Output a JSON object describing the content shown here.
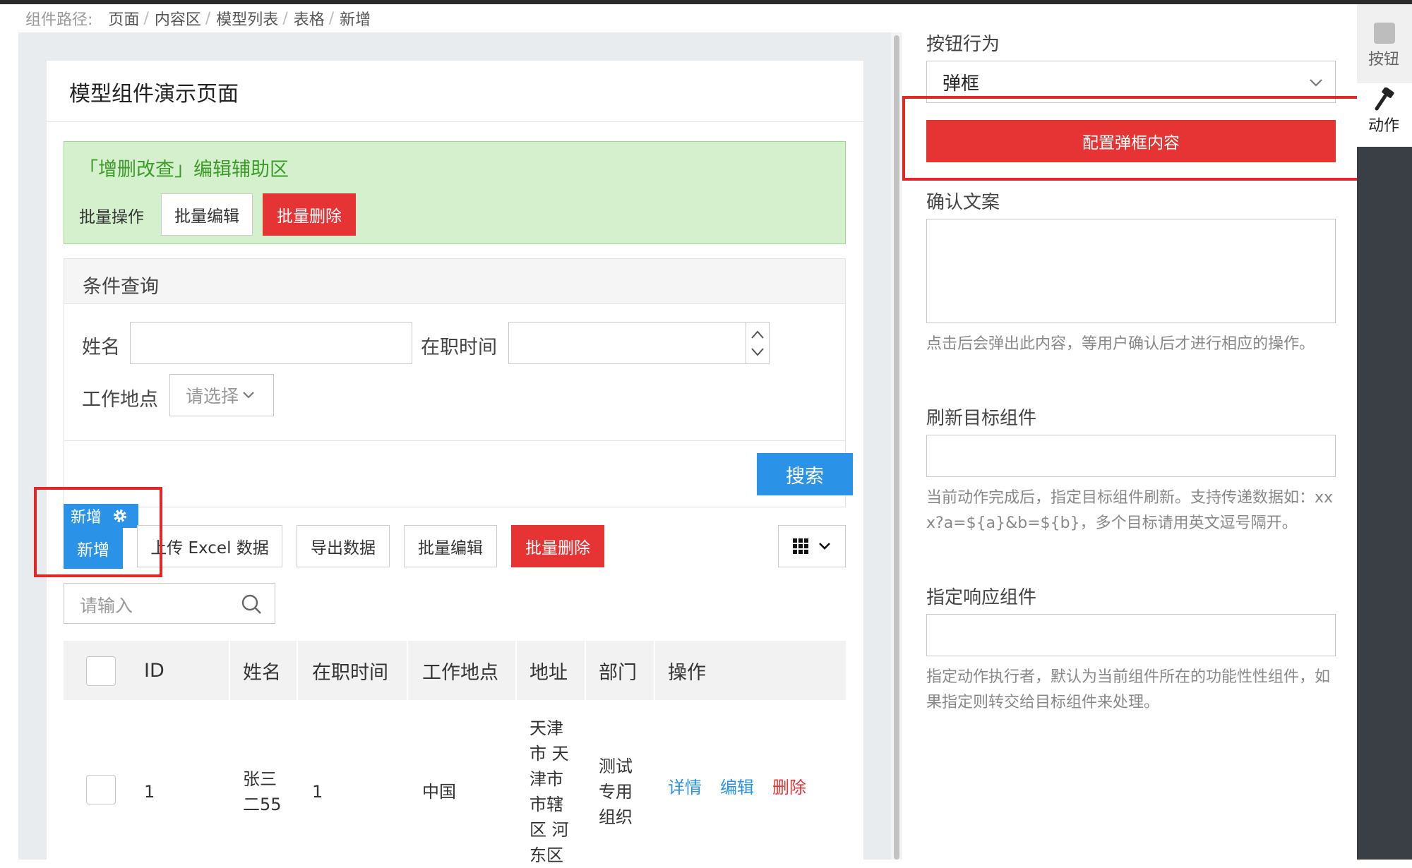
{
  "breadcrumb": {
    "label": "组件路径:",
    "items": [
      "页面",
      "内容区",
      "模型列表",
      "表格",
      "新增"
    ],
    "sep": "/"
  },
  "page": {
    "title": "模型组件演示页面"
  },
  "crud_assist": {
    "title": "「增删改查」编辑辅助区",
    "batch_label": "批量操作",
    "batch_edit": "批量编辑",
    "batch_delete": "批量删除"
  },
  "query": {
    "title": "条件查询",
    "name_label": "姓名",
    "name_value": "",
    "time_label": "在职时间",
    "time_value": "",
    "location_label": "工作地点",
    "location_placeholder": "请选择",
    "search_button": "搜索"
  },
  "toolbar": {
    "badge_label": "新增",
    "add": "新增",
    "upload": "上传 Excel 数据",
    "export": "导出数据",
    "batch_edit": "批量编辑",
    "batch_delete": "批量删除",
    "search_placeholder": "请输入"
  },
  "table": {
    "columns": [
      "ID",
      "姓名",
      "在职时间",
      "工作地点",
      "地址",
      "部门",
      "操作"
    ],
    "rows": [
      {
        "id": "1",
        "name_lines": [
          "张三",
          "二55"
        ],
        "time": "1",
        "location": "中国",
        "address_lines": [
          "天津",
          "市 天",
          "津市",
          "市辖",
          "区 河",
          "东区"
        ],
        "dept_lines": [
          "测试",
          "专用",
          "组织"
        ],
        "actions": {
          "detail": "详情",
          "edit": "编辑",
          "delete": "删除"
        }
      }
    ]
  },
  "right_panel": {
    "action_label": "按钮行为",
    "action_value": "弹框",
    "config_button": "配置弹框内容",
    "confirm_label": "确认文案",
    "confirm_value": "",
    "confirm_hint": "点击后会弹出此内容，等用户确认后才进行相应的操作。",
    "refresh_label": "刷新目标组件",
    "refresh_value": "",
    "refresh_hint": "当前动作完成后，指定目标组件刷新。支持传递数据如：xxx?a=${a}&b=${b}，多个目标请用英文逗号隔开。",
    "response_label": "指定响应组件",
    "response_value": "",
    "response_hint": "指定动作执行者，默认为当前组件所在的功能性性组件，如果指定则转交给目标组件来处理。"
  },
  "side_tabs": {
    "button_tab": "按钮",
    "action_tab": "动作"
  },
  "colors": {
    "primary": "#2a93e8",
    "danger": "#e63333",
    "highlight": "#e32727",
    "assist_bg": "#d4f0cc"
  }
}
